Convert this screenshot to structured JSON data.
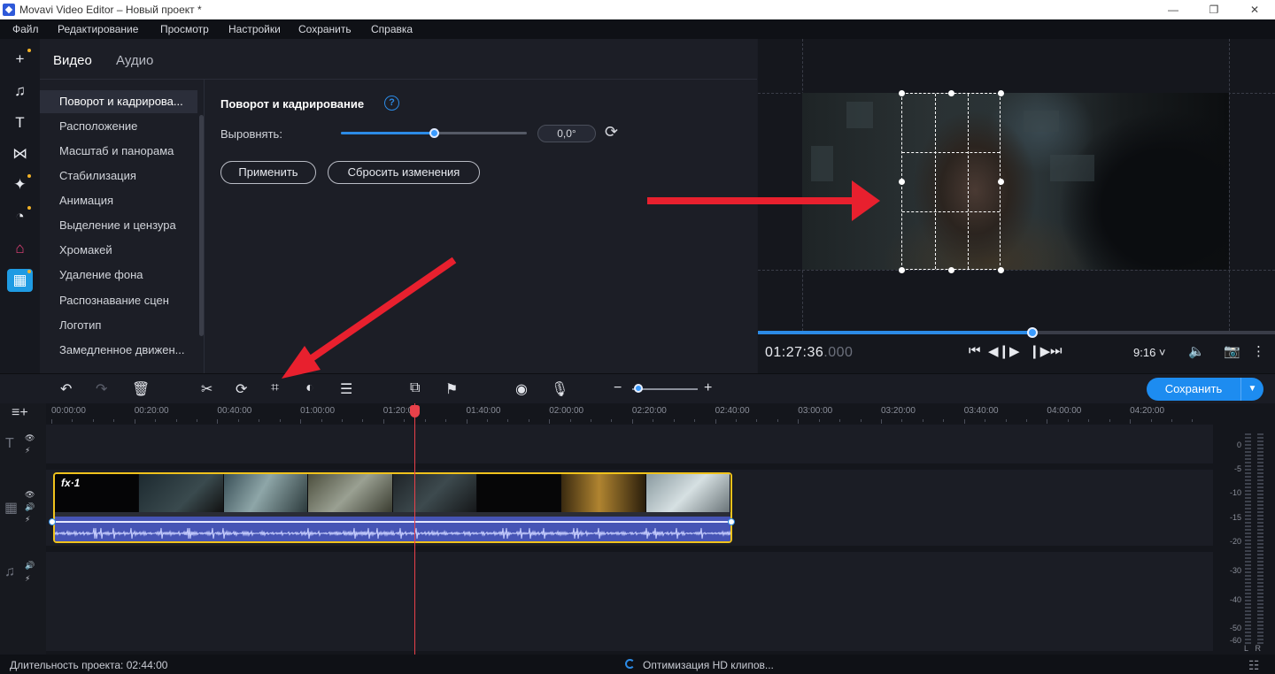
{
  "titlebar": {
    "title": "Movavi Video Editor – Новый проект *",
    "minimize": "—",
    "maximize": "❐",
    "close": "✕"
  },
  "menu": [
    "Файл",
    "Редактирование",
    "Просмотр",
    "Настройки",
    "Сохранить",
    "Справка"
  ],
  "sidebar_tools": [
    {
      "name": "add-media-icon",
      "glyph": "+"
    },
    {
      "name": "music-icon",
      "glyph": "♫"
    },
    {
      "name": "titles-icon",
      "glyph": "T"
    },
    {
      "name": "transitions-icon",
      "glyph": "⋈"
    },
    {
      "name": "effects-icon",
      "glyph": "✦"
    },
    {
      "name": "filters-icon",
      "glyph": "◔"
    },
    {
      "name": "stickers-icon",
      "glyph": "⌂"
    },
    {
      "name": "more-tools-icon",
      "glyph": "▦"
    }
  ],
  "panel": {
    "tabs": {
      "video": "Видео",
      "audio": "Аудио"
    },
    "tools": [
      "Поворот и кадрирова...",
      "Расположение",
      "Масштаб и панорама",
      "Стабилизация",
      "Анимация",
      "Выделение и цензура",
      "Хромакей",
      "Удаление фона",
      "Распознавание сцен",
      "Логотип",
      "Замедленное движен..."
    ],
    "section_title": "Поворот и кадрирование",
    "help": "?",
    "align_label": "Выровнять:",
    "align_value": "0,0°",
    "align_fraction": 0.5,
    "apply": "Применить",
    "reset": "Сбросить изменения"
  },
  "player": {
    "progress_fraction": 0.531,
    "timecode_main": "01:27:36",
    "timecode_frac": ".000",
    "aspect": "9:16 ˅"
  },
  "timeline_toolbar": {
    "export": "Сохранить",
    "export_caret": "▼",
    "zoom_fraction": 0.1
  },
  "ruler": [
    "00:00:00",
    "00:20:00",
    "00:40:00",
    "01:00:00",
    "01:20:00",
    "01:40:00",
    "02:00:00",
    "02:20:00",
    "02:40:00",
    "03:00:00",
    "03:20:00",
    "03:40:00",
    "04:00:00",
    "04:20:00"
  ],
  "clip": {
    "fx": "fx·1"
  },
  "meter": {
    "labels": [
      "0",
      "-5",
      "-10",
      "-15",
      "-20",
      "-30",
      "-40",
      "-50",
      "-60"
    ],
    "channels": [
      "L",
      "R"
    ]
  },
  "status": {
    "duration": "Длительность проекта: 02:44:00",
    "optimizing": "Оптимизация HD клипов..."
  },
  "colors": {
    "accent": "#1d8cf0",
    "clip_border": "#f0c21c",
    "playhead": "#e9414a",
    "annotation_arrow": "#e8202e"
  }
}
